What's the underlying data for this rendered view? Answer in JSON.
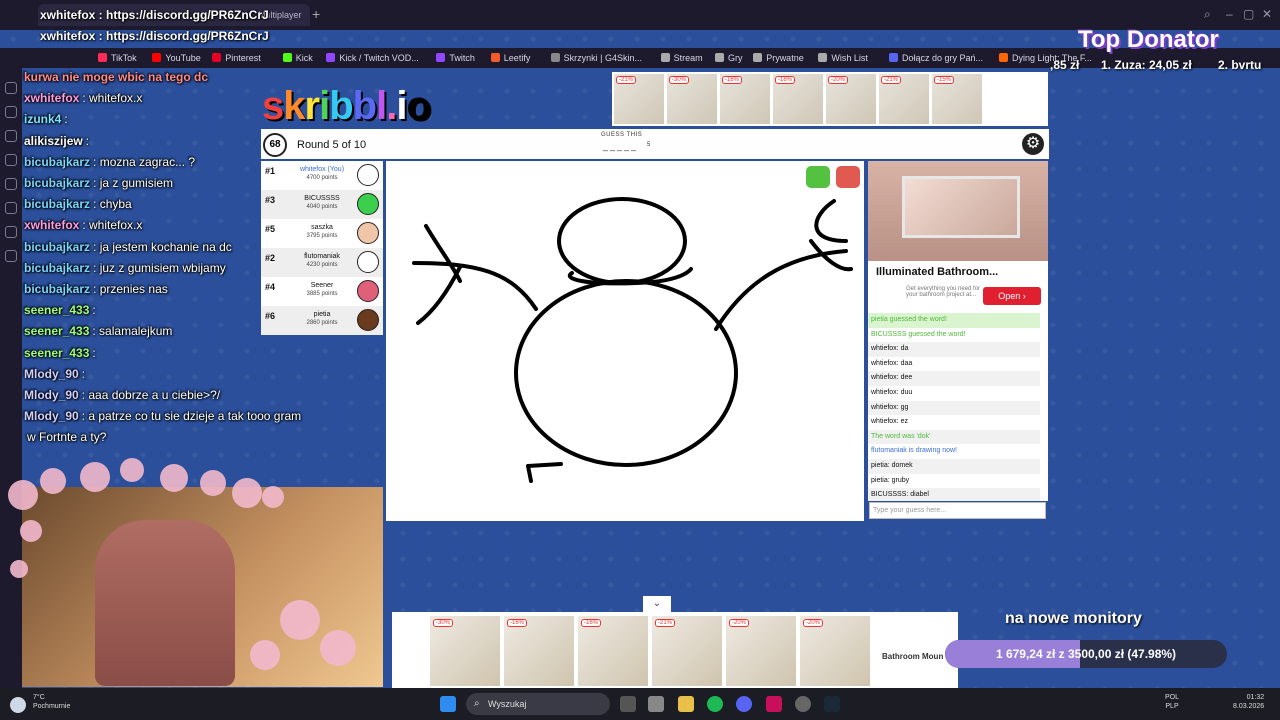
{
  "browser": {
    "tab_title": "Multiplayer",
    "bookmarks": [
      "TikTok",
      "YouTube",
      "Pinterest",
      "Kick",
      "Kick / Twitch VOD...",
      "Twitch",
      "Leetify",
      "Skrzynki | G4Skin...",
      "Stream",
      "Gry",
      "Prywatne",
      "Wish List",
      "Dołącz do gry Pań...",
      "Dying Light: The F..."
    ]
  },
  "overlay": {
    "discord_line1": "xwhitefox : https://discord.gg/PR6ZnCrJ",
    "discord_line2": "xwhitefox : https://discord.gg/PR6ZnCrJ"
  },
  "stream_chat": [
    {
      "user": "kurwa nie moge wbic na tego dc",
      "text": "",
      "color": "#ff8a8a"
    },
    {
      "user": "xwhitefox",
      "text": ": whitefox.x",
      "color": "#ff9de0"
    },
    {
      "user": "izunk4",
      "text": ":",
      "color": "#7be3ff"
    },
    {
      "user": "alikiszijew",
      "text": ":",
      "color": "#ffffff"
    },
    {
      "user": "bicubajkarz",
      "text": ": mozna zagrac... ?",
      "color": "#7ad7ff"
    },
    {
      "user": "bicubajkarz",
      "text": ": ja z gumisiem",
      "color": "#7ad7ff"
    },
    {
      "user": "bicubajkarz",
      "text": ": chyba",
      "color": "#7ad7ff"
    },
    {
      "user": "xwhitefox",
      "text": ": whitefox.x",
      "color": "#ff9de0"
    },
    {
      "user": "bicubajkarz",
      "text": ": ja jestem kochanie na dc",
      "color": "#7ad7ff"
    },
    {
      "user": "bicubajkarz",
      "text": ": juz z gumisiem wbijamy",
      "color": "#7ad7ff"
    },
    {
      "user": "bicubajkarz",
      "text": ": przenies nas",
      "color": "#7ad7ff"
    },
    {
      "user": "seener_433",
      "text": ":",
      "color": "#9cff7a"
    },
    {
      "user": "seener_433",
      "text": ": salamalejkum",
      "color": "#9cff7a"
    },
    {
      "user": "seener_433",
      "text": ":",
      "color": "#9cff7a"
    },
    {
      "user": "Mlody_90",
      "text": ":",
      "color": "#d0d0ff"
    },
    {
      "user": "Mlody_90",
      "text": ": aaa dobrze a u ciebie>?/",
      "color": "#d0d0ff"
    },
    {
      "user": "Mlody_90",
      "text": ": a patrze co tu sie dzieje a tak tooo gram",
      "color": "#d0d0ff"
    },
    {
      "user": "",
      "text": "w Fortnte a ty?",
      "color": "#ffffff"
    }
  ],
  "game": {
    "logo": "skribbl.io",
    "timer": "68",
    "round": "Round 5 of 10",
    "guess_label": "GUESS THIS",
    "word_blank": "_____",
    "word_length": "5",
    "players": [
      {
        "rank": "#1",
        "name": "whitefox (You)",
        "points": "4700 points",
        "you": true,
        "avatar": "#ffffff"
      },
      {
        "rank": "#3",
        "name": "BICUSSSS",
        "points": "4040 points",
        "you": false,
        "avatar": "#3ccf4e"
      },
      {
        "rank": "#5",
        "name": "saszka",
        "points": "3795 points",
        "you": false,
        "avatar": "#f0c6a8"
      },
      {
        "rank": "#2",
        "name": "flutomaniak",
        "points": "4230 points",
        "you": false,
        "avatar": "#ffffff"
      },
      {
        "rank": "#4",
        "name": "Seener",
        "points": "3885 points",
        "you": false,
        "avatar": "#e0607a"
      },
      {
        "rank": "#6",
        "name": "pietia",
        "points": "2860 points",
        "you": false,
        "avatar": "#6a3a1c"
      }
    ],
    "bubble_1": "diabel",
    "bubble_2": "gruby",
    "chat": [
      {
        "text": "pietia guessed the word!",
        "style": "greenbg"
      },
      {
        "text": "BICUSSSS guessed the word!",
        "style": "green"
      },
      {
        "text": "whtiefox: da",
        "style": "alt"
      },
      {
        "text": "whtiefox: daa",
        "style": ""
      },
      {
        "text": "whtiefox: dee",
        "style": "alt"
      },
      {
        "text": "whtiefox: duu",
        "style": ""
      },
      {
        "text": "whtiefox: gg",
        "style": "alt"
      },
      {
        "text": "whtiefox: ez",
        "style": ""
      },
      {
        "text": "The word was 'dok'",
        "style": "green alt"
      },
      {
        "text": "flutomaniak is drawing now!",
        "style": "blue"
      },
      {
        "text": "pietia: domek",
        "style": "alt"
      },
      {
        "text": "pietia: gruby",
        "style": ""
      },
      {
        "text": "BICUSSSS: diabel",
        "style": "alt"
      }
    ],
    "input_placeholder": "Type your guess here..."
  },
  "ads": {
    "top_discounts": [
      "-21%",
      "-30%",
      "-16%",
      "-16%",
      "-20%",
      "-21%",
      "-15%"
    ],
    "side_title": "Illuminated Bathroom...",
    "side_text": "Get everything you need for your bathroom project at...",
    "open_label": "Open",
    "bottom_discounts": [
      "-30%",
      "-16%",
      "-16%",
      "-21%",
      "-20%",
      "-20%"
    ],
    "bottom_brand": "Bathroom Moun"
  },
  "donations": {
    "title": "Top Donator",
    "prev": ",85 zł",
    "first": "1. Zuza: 24,05 zł",
    "second": "2. bvrtu",
    "goal_title": "na nowe monitory",
    "goal_text": "1 679,24 zł  z  3500,00 zł  (47.98%)",
    "goal_fraction": 0.4798
  },
  "taskbar": {
    "weather_temp": "7°C",
    "weather_desc": "Pochmurnie",
    "search": "Wyszukaj",
    "lang": "POL",
    "lang2": "PLP",
    "time": "01:32",
    "date": "8.03.2026"
  }
}
